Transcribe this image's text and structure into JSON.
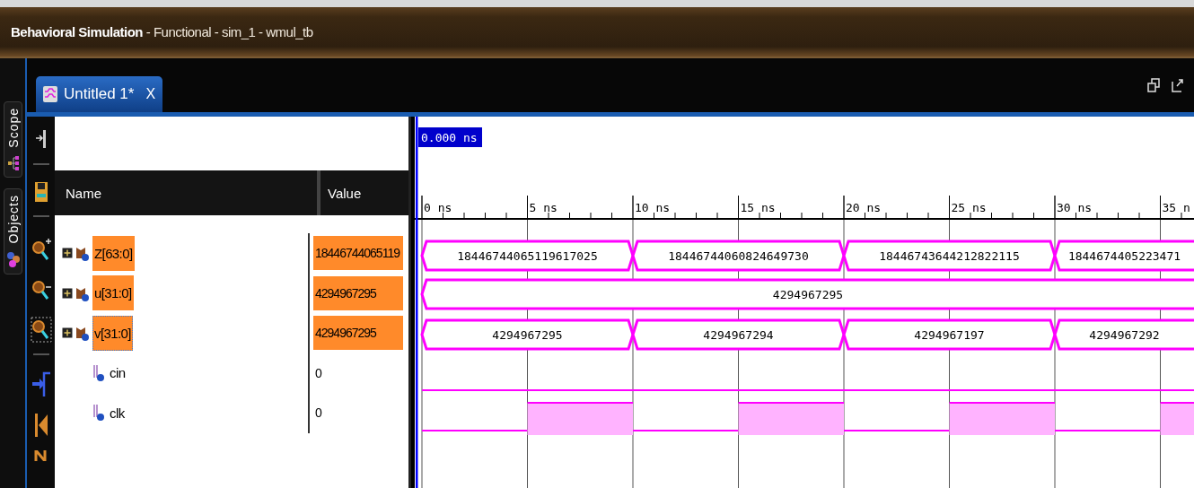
{
  "window": {
    "title": "**Behavioral Simulation** - Functional - sim_1 - wmul_tb"
  },
  "side_tabs": [
    {
      "label": "Scope",
      "kind": "scope"
    },
    {
      "label": "Objects",
      "kind": "objects"
    }
  ],
  "tab": {
    "label": "Untitled 1*",
    "close": "X"
  },
  "toolbar": [
    {
      "kind": "arrow-bar"
    },
    {
      "kind": "save"
    },
    {
      "kind": "zoom-in"
    },
    {
      "kind": "zoom-out"
    },
    {
      "kind": "zoom-fit"
    },
    {
      "kind": "cursor"
    },
    {
      "kind": "start"
    },
    {
      "kind": "next"
    }
  ],
  "columns": {
    "name": "Name",
    "value": "Value"
  },
  "cursor": "0.000 ns",
  "ticks": [
    "0 ns",
    "5 ns",
    "10 ns",
    "15 ns",
    "20 ns",
    "25 ns",
    "30 ns",
    "35 n"
  ],
  "rows": [
    {
      "name": "Z[63:0]",
      "value": "18446744065119",
      "kind": "bus",
      "selected": true,
      "focused": false,
      "segments": [
        "18446744065119617025",
        "18446744060824649730",
        "18446743644212822115",
        "1844674405223471"
      ]
    },
    {
      "name": "u[31:0]",
      "value": "4294967295",
      "kind": "bus",
      "selected": true,
      "focused": false,
      "segments": [
        "4294967295"
      ]
    },
    {
      "name": "v[31:0]",
      "value": "4294967295",
      "kind": "bus",
      "selected": true,
      "focused": true,
      "segments": [
        "4294967295",
        "4294967294",
        "4294967197",
        "4294967292"
      ]
    },
    {
      "name": "cin",
      "value": "0",
      "kind": "bit",
      "selected": false,
      "focused": false,
      "wave": [
        {
          "high": false
        }
      ]
    },
    {
      "name": "clk",
      "value": "0",
      "kind": "bit",
      "selected": false,
      "focused": false,
      "wave": [
        {
          "high": false
        },
        {
          "high": true
        },
        {
          "high": false
        },
        {
          "high": true
        },
        {
          "high": false
        },
        {
          "high": true
        },
        {
          "high": false
        },
        {
          "high": true
        }
      ]
    }
  ]
}
